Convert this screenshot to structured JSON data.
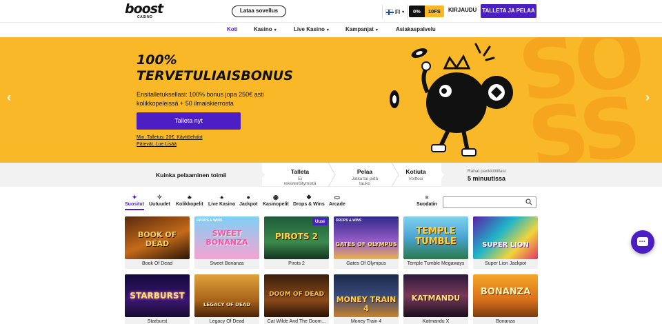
{
  "header": {
    "logo_text": "boost",
    "logo_sub": "CASINO",
    "app_button": "Lataa sovellus",
    "language": "FI",
    "promo_pill_a": "0%",
    "promo_pill_b": "10FS",
    "login": "KIRJAUDU",
    "cta": "TALLETA JA PELAA"
  },
  "nav": {
    "items": [
      {
        "label": "Koti",
        "active": true
      },
      {
        "label": "Kasino"
      },
      {
        "label": "Live Kasino"
      },
      {
        "label": "Kampanjat"
      },
      {
        "label": "Asiakaspalvelu"
      }
    ]
  },
  "hero": {
    "title_line1": "100%",
    "title_line2": "TERVETULIAISBONUS",
    "desc": "Ensitalletuksellasi: 100% bonus jopa 250€ asti kolikkopeleissä + 50 ilmaiskierrosta",
    "button": "Talleta nyt",
    "terms": "Min. Talletus: 20€. Käyttöehdot Pätevät. Lue Lisää"
  },
  "steps": {
    "intro": "Kuinka pelaaminen toimii",
    "items": [
      {
        "title": "Talleta",
        "sub": "Ei rekisteröitymistä"
      },
      {
        "title": "Pelaa",
        "sub": "Jatka tai pidä tauko"
      },
      {
        "title": "Kotiuta",
        "sub": "Voittosi"
      }
    ],
    "payout_label": "Rahat pankkitilillasi",
    "payout_value": "5 minuutissa"
  },
  "categories": {
    "items": [
      {
        "label": "Suositut",
        "icon": "star-tag-icon"
      },
      {
        "label": "Uutuudet",
        "icon": "sparkle-icon"
      },
      {
        "label": "Kolikkopelit",
        "icon": "cherries-icon"
      },
      {
        "label": "Live Kasino",
        "icon": "spade-icon"
      },
      {
        "label": "Jackpot",
        "icon": "money-bag-icon"
      },
      {
        "label": "Kasinopelit",
        "icon": "chip-icon"
      },
      {
        "label": "Drops & Wins",
        "icon": "drops-icon"
      },
      {
        "label": "Arcade",
        "icon": "ticket-icon"
      }
    ],
    "filter": "Suodatin",
    "search_placeholder": ""
  },
  "games": [
    {
      "name": "Book Of Dead",
      "art": "BOOK OF DEAD"
    },
    {
      "name": "Sweet Bonanza",
      "art": "SWEET BONANZA",
      "drops": "DROPS & WINS"
    },
    {
      "name": "Pirots 2",
      "art": "PIROTS 2",
      "badge": "Uusi"
    },
    {
      "name": "Gates Of Olympus",
      "art": "GATES OF OLYMPUS",
      "drops": "DROPS & WINS"
    },
    {
      "name": "Temple Tumble Megaways",
      "art": "TEMPLE TUMBLE"
    },
    {
      "name": "Super Lion Jackpot",
      "art": "SUPER LION"
    },
    {
      "name": "Starburst",
      "art": "STARBURST"
    },
    {
      "name": "Legacy Of Dead",
      "art": "LEGACY OF DEAD"
    },
    {
      "name": "Cat Wilde And The Doom...",
      "art": "DOOM OF DEAD"
    },
    {
      "name": "Money Train 4",
      "art": "MONEY TRAIN 4"
    },
    {
      "name": "Katmandu X",
      "art": "KATMANDU"
    },
    {
      "name": "Bonanza",
      "art": "BONANZA"
    }
  ],
  "colors": {
    "brand_purple": "#4b1fc4",
    "hero_yellow": "#f9b827"
  }
}
